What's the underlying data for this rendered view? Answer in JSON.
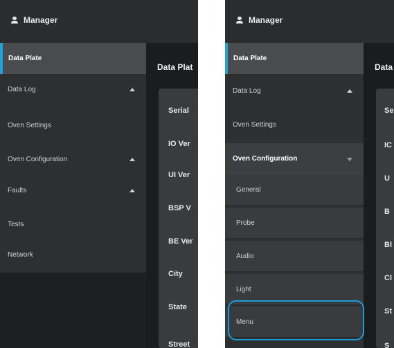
{
  "topbar": {
    "user_label": "Manager"
  },
  "left": {
    "menu": [
      {
        "label": "Data Plate",
        "state": "active",
        "chevron": ""
      },
      {
        "label": "Data Log",
        "state": "",
        "chevron": "up"
      },
      {
        "label": "Oven Settings",
        "state": "",
        "chevron": ""
      },
      {
        "label": "Oven Configuration",
        "state": "",
        "chevron": "up"
      },
      {
        "label": "Faults",
        "state": "",
        "chevron": "up"
      },
      {
        "label": "Tests",
        "state": "",
        "chevron": ""
      },
      {
        "label": "Network",
        "state": "",
        "chevron": ""
      }
    ],
    "content_title": "Data Plat",
    "rows": [
      "Serial",
      "IO Ver",
      "UI Ver",
      "BSP V",
      "BE Ver",
      "City",
      "State",
      "Street"
    ]
  },
  "right": {
    "menu": [
      {
        "label": "Data Plate",
        "state": "active",
        "chevron": ""
      },
      {
        "label": "Data Log",
        "state": "",
        "chevron": "up"
      },
      {
        "label": "Oven Settings",
        "state": "",
        "chevron": ""
      },
      {
        "label": "Oven Configuration",
        "state": "open",
        "chevron": "down"
      },
      {
        "label": "General",
        "state": "sub",
        "chevron": ""
      },
      {
        "label": "Probe",
        "state": "sub",
        "chevron": ""
      },
      {
        "label": "Audio",
        "state": "sub",
        "chevron": ""
      },
      {
        "label": "Light",
        "state": "sub",
        "chevron": ""
      },
      {
        "label": "Menu",
        "state": "sub",
        "chevron": ""
      }
    ],
    "content_title": "Data",
    "rows": [
      "Se",
      "IC",
      "U",
      "B",
      "Bl",
      "Cl",
      "St",
      "S"
    ]
  },
  "colors": {
    "accent": "#1fa2d6",
    "highlight": "#1aa0d8",
    "sidebar": "#2e2f31",
    "topbar": "#2b2c2e"
  }
}
